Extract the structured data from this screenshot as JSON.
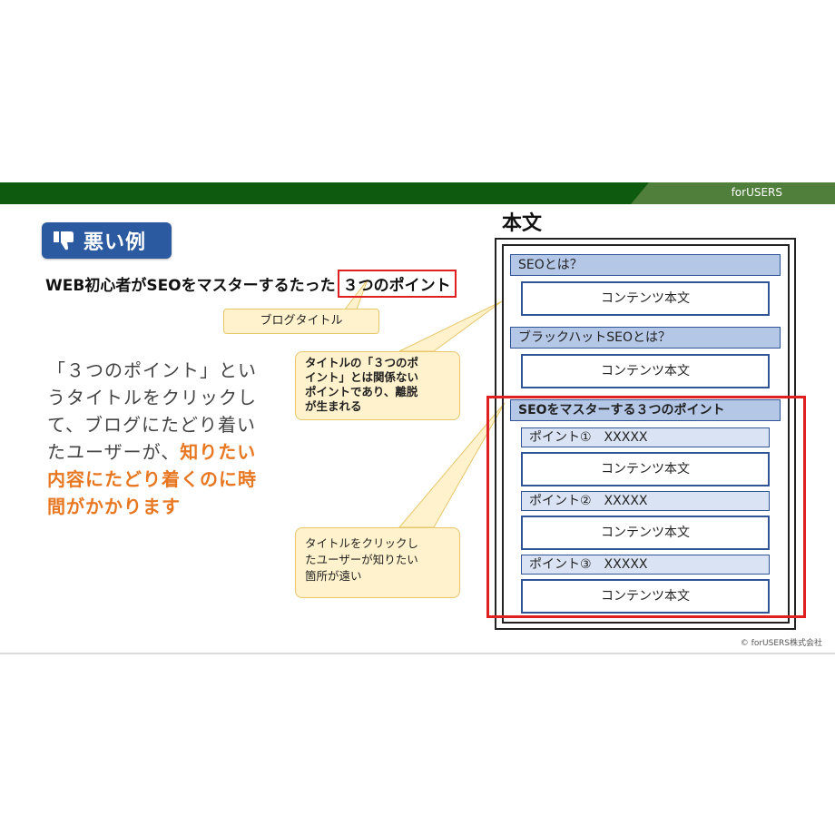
{
  "header": {
    "brand": "forUSERS"
  },
  "badge": {
    "icon": "thumbs-down-icon",
    "label": "悪い例"
  },
  "headline": {
    "prefix": "WEB初心者がSEOをマスターするたった",
    "highlight": "３つのポイント"
  },
  "callouts": {
    "blog_title": "ブログタイトル",
    "unrelated_lines": [
      "タイトルの「３つのポ",
      "イント」とは関係ない",
      "ポイントであり、離脱",
      "が生まれる"
    ],
    "far_lines": [
      "タイトルをクリックし",
      "たユーザーが知りたい",
      "箇所が遠い"
    ]
  },
  "body": {
    "line1": "「３つのポイント」とい",
    "line2": "うタイトルをクリックし",
    "line3": "て、ブログにたどり着い",
    "line4_plain": "たユーザーが、",
    "line4_em": "知りたい",
    "line5": "内容にたどり着くのに時",
    "line6": "間がかかります"
  },
  "document": {
    "label": "本文",
    "sections": [
      {
        "title": "SEOとは？",
        "content": "コンテンツ本文"
      },
      {
        "title": "ブラックハットSEOとは？",
        "content": "コンテンツ本文"
      },
      {
        "title": "SEOをマスターする３つのポイント"
      }
    ],
    "points": [
      {
        "title": "ポイント①　XXXXX",
        "content": "コンテンツ本文"
      },
      {
        "title": "ポイント②　XXXXX",
        "content": "コンテンツ本文"
      },
      {
        "title": "ポイント③　XXXXX",
        "content": "コンテンツ本文"
      }
    ]
  },
  "footer": {
    "copyright": "© forUSERS株式会社"
  },
  "colors": {
    "header_green": "#0e5a0e",
    "badge_blue": "#2c5aa0",
    "highlight_red": "#e02020",
    "emphasis_orange": "#e87722",
    "callout_yellow": "#fff2cc"
  }
}
